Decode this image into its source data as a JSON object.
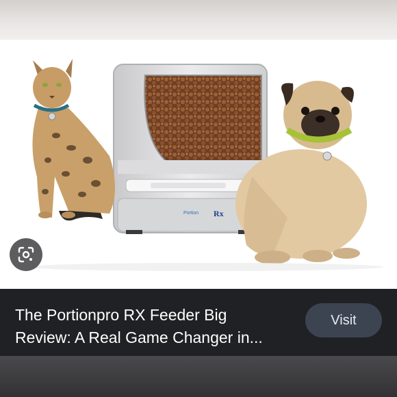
{
  "result": {
    "title": "The Portionpro RX Feeder Big\nReview: A Real Game Changer in...",
    "visit_label": "Visit",
    "product_label_left": "Portion",
    "product_label_right": "Rx"
  },
  "icons": {
    "lens": "google-lens-icon"
  },
  "colors": {
    "caption_bg": "#202124",
    "visit_bg": "#3c4452",
    "lens_bg": "#5d5d60"
  }
}
